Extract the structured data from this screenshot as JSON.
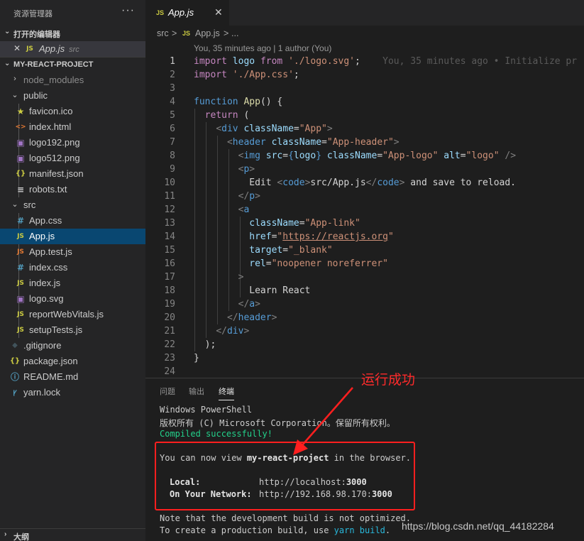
{
  "sidebar": {
    "title": "资源管理器",
    "more_icon": "ellipsis-icon",
    "open_editors": {
      "label": "打开的编辑器",
      "items": [
        {
          "name": "App.js",
          "desc": "src",
          "icon": "JS"
        }
      ]
    },
    "project": {
      "label": "MY-REACT-PROJECT",
      "tree": [
        {
          "name": "node_modules",
          "type": "folder",
          "icon": ""
        },
        {
          "name": "public",
          "type": "folder",
          "icon": ""
        },
        {
          "name": "favicon.ico",
          "type": "file",
          "icon": "★"
        },
        {
          "name": "index.html",
          "type": "file",
          "icon": "<>"
        },
        {
          "name": "logo192.png",
          "type": "file",
          "icon": "▣"
        },
        {
          "name": "logo512.png",
          "type": "file",
          "icon": "▣"
        },
        {
          "name": "manifest.json",
          "type": "file",
          "icon": "{}"
        },
        {
          "name": "robots.txt",
          "type": "file",
          "icon": "≡"
        },
        {
          "name": "src",
          "type": "folder",
          "icon": ""
        },
        {
          "name": "App.css",
          "type": "file",
          "icon": "#"
        },
        {
          "name": "App.js",
          "type": "file",
          "icon": "JS"
        },
        {
          "name": "App.test.js",
          "type": "file",
          "icon": "JS"
        },
        {
          "name": "index.css",
          "type": "file",
          "icon": "#"
        },
        {
          "name": "index.js",
          "type": "file",
          "icon": "JS"
        },
        {
          "name": "logo.svg",
          "type": "file",
          "icon": "▣"
        },
        {
          "name": "reportWebVitals.js",
          "type": "file",
          "icon": "JS"
        },
        {
          "name": "setupTests.js",
          "type": "file",
          "icon": "JS"
        },
        {
          "name": ".gitignore",
          "type": "file",
          "icon": "◆"
        },
        {
          "name": "package.json",
          "type": "file",
          "icon": "{}"
        },
        {
          "name": "README.md",
          "type": "file",
          "icon": "ⓘ"
        },
        {
          "name": "yarn.lock",
          "type": "file",
          "icon": "🧶"
        }
      ]
    },
    "outline_label": "大纲"
  },
  "tab": {
    "name": "App.js",
    "icon": "JS",
    "close": "✕"
  },
  "breadcrumb": {
    "folder": "src",
    "sep": ">",
    "file": "App.js",
    "tail": "..."
  },
  "codelens": "You, 35 minutes ago | 1 author (You)",
  "editor": {
    "blame": "You, 35 minutes ago • Initialize pr",
    "line_numbers": [
      "1",
      "2",
      "3",
      "4",
      "5",
      "6",
      "7",
      "8",
      "9",
      "10",
      "11",
      "12",
      "13",
      "14",
      "15",
      "16",
      "17",
      "18",
      "19",
      "20",
      "21",
      "22",
      "23",
      "24"
    ]
  },
  "panel": {
    "tabs": [
      "问题",
      "输出",
      "终端"
    ],
    "terminal": {
      "l1": "Windows PowerShell",
      "l2": "版权所有 (C) Microsoft Corporation。保留所有权利。",
      "compiled": "Compiled successfully!",
      "view_pre": "You can now view ",
      "project": "my-react-project",
      "view_post": " in the browser.",
      "local_label": "Local:",
      "local_url_pre": "http://localhost:",
      "local_port": "3000",
      "net_label": "On Your Network:",
      "net_url_pre": "http://192.168.98.170:",
      "net_port": "3000",
      "note1": "Note that the development build is not optimized.",
      "note2_pre": "To create a production build, use ",
      "note2_cmd": "yarn build",
      "note2_post": "."
    }
  },
  "annotation": {
    "text": "运行成功"
  },
  "watermark": "https://blog.csdn.net/qq_44182284",
  "colors": {
    "accent": "#094771",
    "annotation": "#ff1f1f",
    "success": "#23d18b"
  }
}
